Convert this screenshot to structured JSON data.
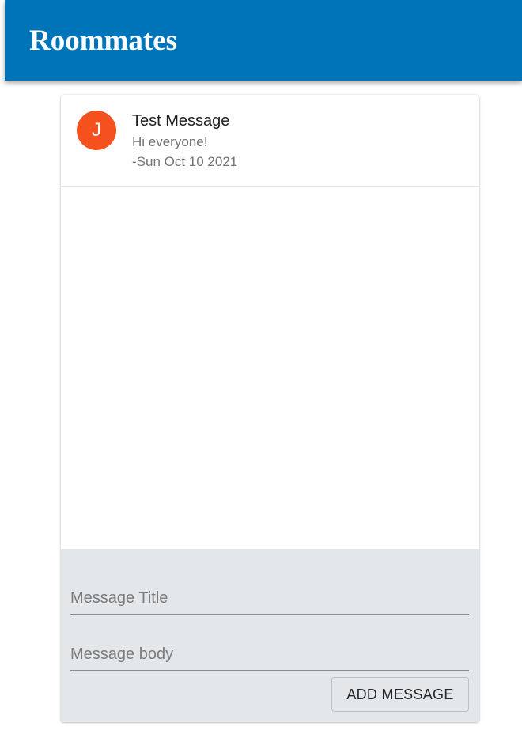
{
  "app": {
    "title": "Roommates",
    "brand_color": "#0074b9"
  },
  "messages": [
    {
      "avatar_initial": "J",
      "avatar_color": "#f4511e",
      "title": "Test Message",
      "body": "Hi everyone!",
      "date": "-Sun Oct 10 2021"
    }
  ],
  "composer": {
    "title_placeholder": "Message Title",
    "title_value": "",
    "body_placeholder": "Message body",
    "body_value": "",
    "add_button_label": "ADD MESSAGE"
  }
}
